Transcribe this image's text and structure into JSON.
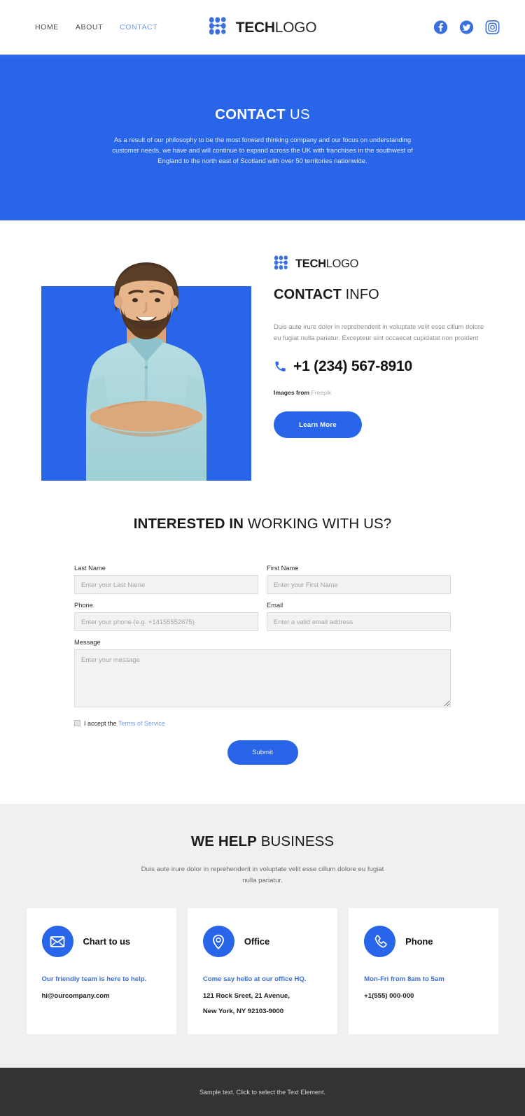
{
  "header": {
    "nav": [
      {
        "label": "HOME",
        "active": false
      },
      {
        "label": "ABOUT",
        "active": false
      },
      {
        "label": "CONTACT",
        "active": true
      }
    ],
    "logo": {
      "bold": "TECH",
      "light": "LOGO"
    },
    "social": [
      {
        "name": "facebook-icon",
        "label": "Facebook"
      },
      {
        "name": "twitter-icon",
        "label": "Twitter"
      },
      {
        "name": "instagram-icon",
        "label": "Instagram"
      }
    ]
  },
  "hero": {
    "title_bold": "CONTACT",
    "title_light": " US",
    "subtitle": "As a result of our philosophy to be the most forward thinking company and our focus on understanding customer needs, we have and will continue to expand across the UK with franchises in the southwest of England to the north east of Scotland with over 50 territories nationwide."
  },
  "info": {
    "logo": {
      "bold": "TECH",
      "light": "LOGO"
    },
    "title_bold": "CONTACT",
    "title_light": " INFO",
    "body": "Duis aute irure dolor in reprehenderit in voluptate velit esse cillum dolore eu fugiat nulla pariatur. Excepteur sint occaecat cupidatat non proident",
    "phone": "+1 (234) 567-8910",
    "credit_prefix": "Images from ",
    "credit_source": "Freepik",
    "cta_label": "Learn More"
  },
  "form": {
    "heading_bold": "INTERESTED IN",
    "heading_light": " WORKING WITH US?",
    "fields": [
      {
        "label": "Last Name",
        "placeholder": "Enter your Last Name",
        "name": "last-name"
      },
      {
        "label": "First Name",
        "placeholder": "Enter your First Name",
        "name": "first-name"
      },
      {
        "label": "Phone",
        "placeholder": "Enter your phone (e.g. +14155552675)",
        "name": "phone"
      },
      {
        "label": "Email",
        "placeholder": "Enter a valid email address",
        "name": "email"
      }
    ],
    "message": {
      "label": "Message",
      "placeholder": "Enter your message"
    },
    "accept_text": "I accept the ",
    "terms_label": "Terms of Service",
    "submit_label": "Submit"
  },
  "help": {
    "heading_bold": "WE HELP",
    "heading_light": " BUSINESS",
    "subtitle": "Duis aute irure dolor in reprehenderit in voluptate velit esse cillum dolore eu fugiat nulla pariatur.",
    "cards": [
      {
        "icon": "envelope-icon",
        "title": "Chart to us",
        "tagline": "Our friendly team is here to help.",
        "lines": [
          "hi@ourcompany.com"
        ]
      },
      {
        "icon": "map-pin-icon",
        "title": "Office",
        "tagline": "Come say hello at our office HQ.",
        "lines": [
          "121 Rock Sreet, 21 Avenue,",
          "New York, NY 92103-9000"
        ]
      },
      {
        "icon": "phone-icon",
        "title": "Phone",
        "tagline": "Mon-Fri from 8am to 5am",
        "lines": [
          "+1(555) 000-000"
        ]
      }
    ]
  },
  "footer": {
    "text": "Sample text. Click to select the Text Element."
  },
  "colors": {
    "brand_blue": "#2965e8",
    "hero_blue": "#2965e8",
    "active_nav": "#6f9bf0",
    "section_gray": "#f0f0f0",
    "footer_dark": "#333333",
    "input_gray": "#f2f2f2"
  }
}
